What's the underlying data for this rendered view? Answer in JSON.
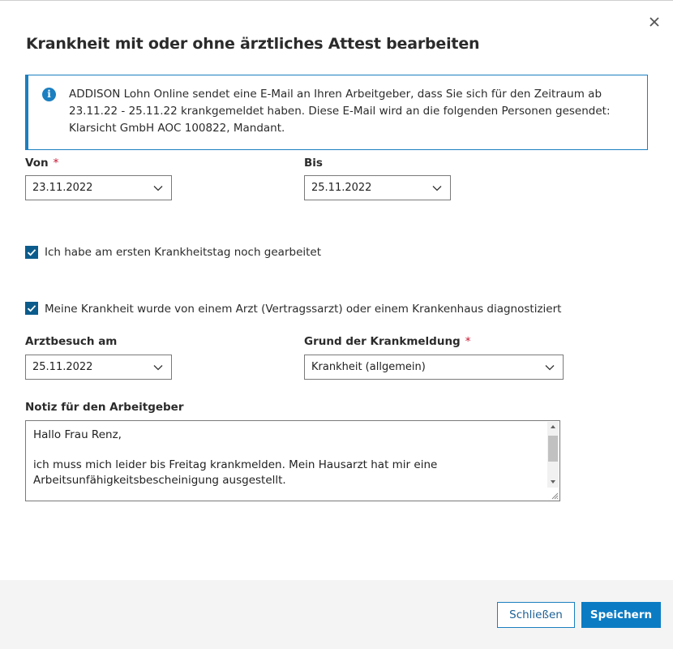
{
  "dialog": {
    "title": "Krankheit mit oder ohne ärztliches Attest bearbeiten",
    "close_icon": "close-icon"
  },
  "info": {
    "icon": "info-icon",
    "icon_glyph": "i",
    "text": "ADDISON Lohn Online sendet eine E-Mail an Ihren Arbeitgeber, dass Sie sich für den Zeitraum ab 23.11.22 - 25.11.22 krankgemeldet haben. Diese E-Mail wird an die folgenden Personen gesendet: Klarsicht GmbH AOC 100822, Mandant."
  },
  "form": {
    "von": {
      "label": "Von",
      "required": "*",
      "value": "23.11.2022"
    },
    "bis": {
      "label": "Bis",
      "value": "25.11.2022"
    },
    "checkbox_first_day": {
      "label": "Ich habe am ersten Krankheitstag noch gearbeitet",
      "checked": true
    },
    "checkbox_diagnosed": {
      "label": "Meine Krankheit wurde von einem Arzt (Vertragssarzt) oder einem Krankenhaus diagnostiziert",
      "checked": true
    },
    "arztbesuch": {
      "label": "Arztbesuch am",
      "value": "25.11.2022"
    },
    "grund": {
      "label": "Grund der Krankmeldung",
      "required": "*",
      "value": "Krankheit (allgemein)"
    },
    "notiz": {
      "label": "Notiz für den Arbeitgeber",
      "value": "Hallo Frau Renz,\n\nich muss mich leider bis Freitag krankmelden. Mein Hausarzt hat mir eine Arbeitsunfähigkeitsbescheinigung ausgestellt."
    }
  },
  "footer": {
    "close_label": "Schließen",
    "save_label": "Speichern"
  },
  "colors": {
    "accent": "#0b7cc4",
    "info_border": "#1b7fc0",
    "checkbox": "#0b5c8c",
    "required": "#c8102e",
    "footer_bg": "#f4f4f4"
  }
}
